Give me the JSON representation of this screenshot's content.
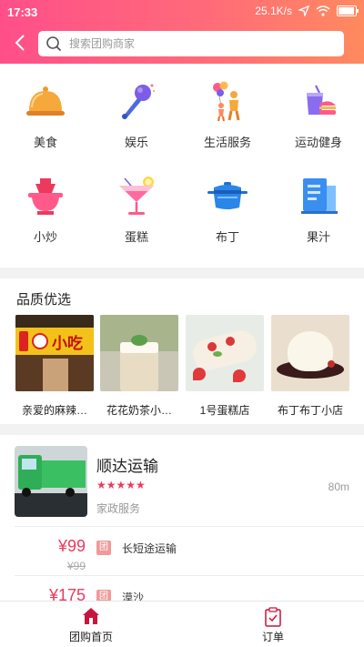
{
  "status_bar": {
    "time": "17:33",
    "speed": "25.1K/s"
  },
  "search": {
    "placeholder": "搜索团购商家"
  },
  "categories": [
    {
      "label": "美食",
      "icon": "food-cloche-icon"
    },
    {
      "label": "娱乐",
      "icon": "microphone-icon"
    },
    {
      "label": "生活服务",
      "icon": "family-balloons-icon"
    },
    {
      "label": "运动健身",
      "icon": "drink-burger-icon"
    },
    {
      "label": "小炒",
      "icon": "hotpot-icon"
    },
    {
      "label": "蛋糕",
      "icon": "cocktail-icon"
    },
    {
      "label": "布丁",
      "icon": "pot-icon"
    },
    {
      "label": "果汁",
      "icon": "building-icon"
    }
  ],
  "quality": {
    "title": "品质优选",
    "items": [
      {
        "name": "亲爱的麻辣…",
        "sign_text": "小吃"
      },
      {
        "name": "花花奶茶小…"
      },
      {
        "name": "1号蛋糕店"
      },
      {
        "name": "布丁布丁小店"
      }
    ]
  },
  "business": {
    "name": "顺达运输",
    "stars": "★★★★★",
    "rating": 5,
    "distance": "80m",
    "category": "家政服务",
    "deals": [
      {
        "price": "¥99",
        "original": "¥99",
        "tag": "团",
        "name": "长短途运输"
      },
      {
        "price": "¥175",
        "tag": "团",
        "name": "漠沙"
      }
    ]
  },
  "tabbar": {
    "tabs": [
      {
        "label": "团购首页",
        "icon": "home-icon"
      },
      {
        "label": "订单",
        "icon": "order-icon"
      }
    ]
  },
  "colors": {
    "accent": "#ec3a5e",
    "header_start": "#ff4f8a",
    "header_end": "#ff8a5e"
  }
}
